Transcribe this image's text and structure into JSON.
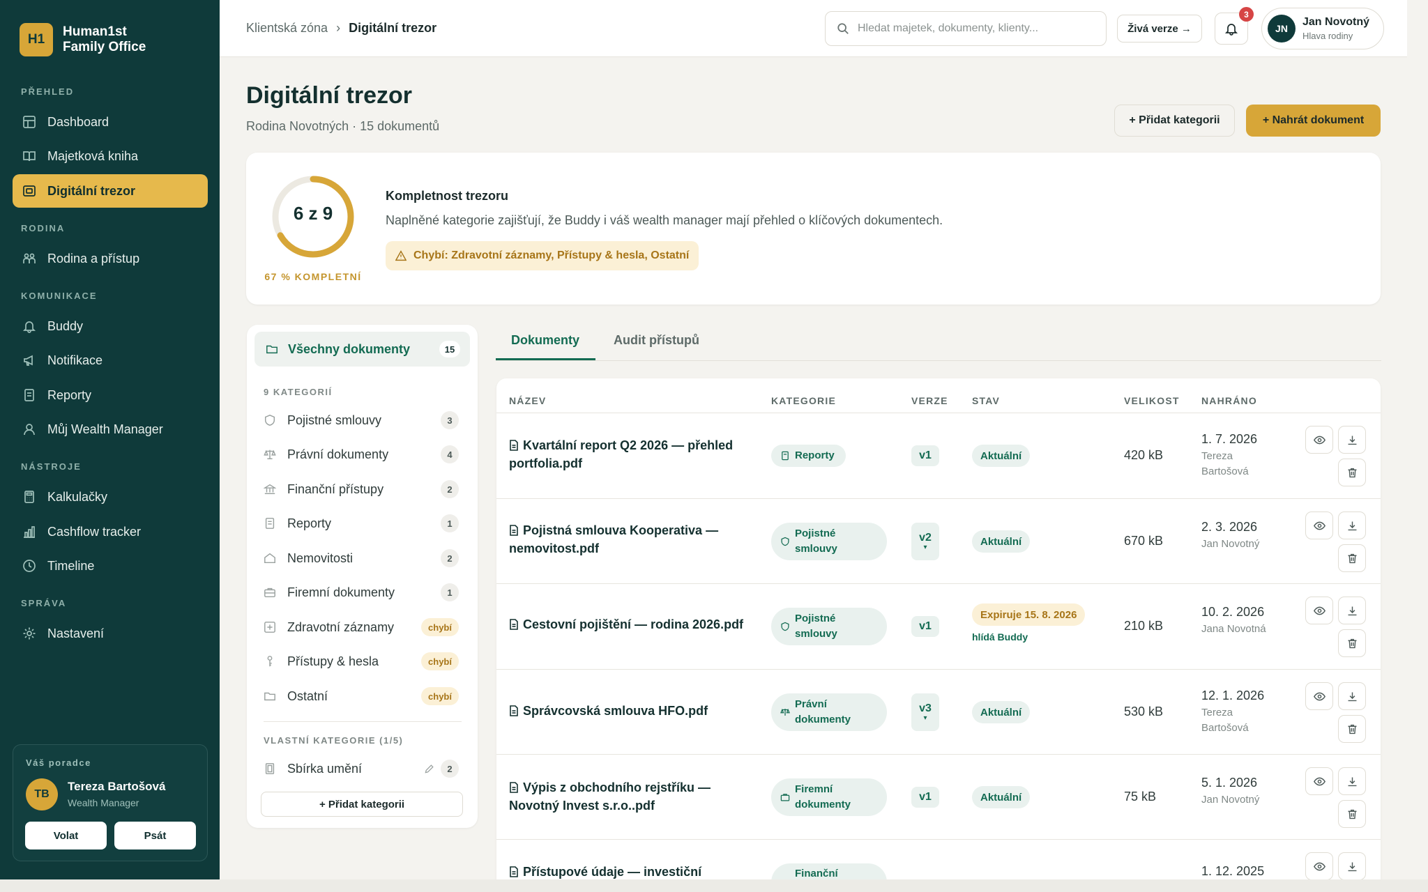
{
  "app": {
    "logo_initials": "H1",
    "logo_line1": "Human1st",
    "logo_line2": "Family Office"
  },
  "sidebar": {
    "sections": [
      {
        "label": "PŘEHLED"
      },
      {
        "label": "RODINA"
      },
      {
        "label": "KOMUNIKACE"
      },
      {
        "label": "NÁSTROJE"
      },
      {
        "label": "SPRÁVA"
      }
    ],
    "items": [
      {
        "label": "Dashboard",
        "icon": "grid-icon"
      },
      {
        "label": "Majetková kniha",
        "icon": "book-icon"
      },
      {
        "label": "Digitální trezor",
        "icon": "vault-icon",
        "active": true
      },
      {
        "label": "Rodina a přístup",
        "icon": "family-icon"
      },
      {
        "label": "Buddy",
        "icon": "bell-icon"
      },
      {
        "label": "Notifikace",
        "icon": "megaphone-icon"
      },
      {
        "label": "Reporty",
        "icon": "report-icon"
      },
      {
        "label": "Můj Wealth Manager",
        "icon": "user-icon"
      },
      {
        "label": "Kalkulačky",
        "icon": "calculator-icon"
      },
      {
        "label": "Cashflow tracker",
        "icon": "chart-icon"
      },
      {
        "label": "Timeline",
        "icon": "clock-icon"
      },
      {
        "label": "Nastavení",
        "icon": "gear-icon"
      }
    ],
    "advisor": {
      "label": "Váš poradce",
      "initials": "TB",
      "name": "Tereza Bartošová",
      "role": "Wealth Manager",
      "call": "Volat",
      "write": "Psát"
    }
  },
  "header": {
    "breadcrumb_root": "Klientská zóna",
    "breadcrumb_sep": "›",
    "breadcrumb_current": "Digitální trezor",
    "search_placeholder": "Hledat majetek, dokumenty, klienty...",
    "live_label": "Živá verze →",
    "notifications": "3",
    "user_initials": "JN",
    "user_name": "Jan Novotný",
    "user_role": "Hlava rodiny"
  },
  "page": {
    "title": "Digitální trezor",
    "subtitle": "Rodina Novotných · 15 dokumentů",
    "add_category": "+ Přidat kategorii",
    "upload": "+ Nahrát dokument"
  },
  "completeness": {
    "ratio_text": "6 z 9",
    "filled": 6,
    "total": 9,
    "percent_label": "67 % KOMPLETNÍ",
    "title": "Kompletnost trezoru",
    "description": "Naplněné kategorie zajišťují, že Buddy i váš wealth manager mají přehled o klíčových dokumentech.",
    "missing": "Chybí: Zdravotní záznamy, Přístupy & hesla, Ostatní",
    "accent": "#d7a638"
  },
  "categories": {
    "all_label": "Všechny dokumenty",
    "all_count": "15",
    "section_label": "9 KATEGORIÍ",
    "items": [
      {
        "label": "Pojistné smlouvy",
        "count": "3",
        "icon": "shield-icon"
      },
      {
        "label": "Právní dokumenty",
        "count": "4",
        "icon": "scale-icon"
      },
      {
        "label": "Finanční přístupy",
        "count": "2",
        "icon": "bank-icon"
      },
      {
        "label": "Reporty",
        "count": "1",
        "icon": "report-icon"
      },
      {
        "label": "Nemovitosti",
        "count": "2",
        "icon": "house-icon"
      },
      {
        "label": "Firemní dokumenty",
        "count": "1",
        "icon": "briefcase-icon"
      },
      {
        "label": "Zdravotní záznamy",
        "count": "chybí",
        "icon": "medical-icon"
      },
      {
        "label": "Přístupy & hesla",
        "count": "chybí",
        "icon": "key-icon"
      },
      {
        "label": "Ostatní",
        "count": "chybí",
        "icon": "folder-icon"
      }
    ],
    "custom_label": "VLASTNÍ KATEGORIE (1/5)",
    "custom_items": [
      {
        "label": "Sbírka umění",
        "count": "2",
        "icon": "frame-icon"
      }
    ],
    "add_label": "+ Přidat kategorii"
  },
  "tabs": [
    {
      "label": "Dokumenty"
    },
    {
      "label": "Audit přístupů"
    }
  ],
  "table": {
    "headers": [
      "NÁZEV",
      "KATEGORIE",
      "VERZE",
      "STAV",
      "VELIKOST",
      "NAHRÁNO"
    ],
    "rows": [
      {
        "name": "Kvartální report Q2 2026 — přehled portfolia.pdf",
        "category": "Reporty",
        "version": "v1",
        "status": "Aktuální",
        "size": "420 kB",
        "date": "1. 7. 2026",
        "by": "Tereza Bartošová"
      },
      {
        "name": "Pojistná smlouva Kooperativa — nemovitost.pdf",
        "category": "Pojistné smlouvy",
        "version": "v2",
        "version_more": "▾",
        "status": "Aktuální",
        "size": "670 kB",
        "date": "2. 3. 2026",
        "by": "Jan Novotný"
      },
      {
        "name": "Cestovní pojištění — rodina 2026.pdf",
        "category": "Pojistné smlouvy",
        "version": "v1",
        "status": "Expiruje 15. 8. 2026",
        "status_note": "hlídá Buddy",
        "size": "210 kB",
        "date": "10. 2. 2026",
        "by": "Jana Novotná"
      },
      {
        "name": "Správcovská smlouva HFO.pdf",
        "category": "Právní dokumenty",
        "version": "v3",
        "version_more": "▾",
        "status": "Aktuální",
        "size": "530 kB",
        "date": "12. 1. 2026",
        "by": "Tereza Bartošová"
      },
      {
        "name": "Výpis z obchodního rejstříku — Novotný Invest s.r.o..pdf",
        "category": "Firemní dokumenty",
        "version": "v1",
        "status": "Aktuální",
        "size": "75 kB",
        "date": "5. 1. 2026",
        "by": "Jan Novotný"
      },
      {
        "name": "Přístupové údaje — investiční",
        "category": "Finanční",
        "date": "1. 12. 2025"
      }
    ]
  }
}
